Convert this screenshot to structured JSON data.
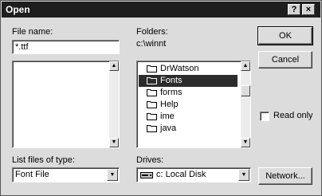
{
  "window": {
    "title": "Open",
    "help_label": "?",
    "close_label": "×"
  },
  "file_name": {
    "label": "File name:",
    "value": "*.ttf"
  },
  "folders": {
    "label": "Folders:",
    "path": "c:\\winnt",
    "items": [
      {
        "name": "DrWatson",
        "selected": false
      },
      {
        "name": "Fonts",
        "selected": true
      },
      {
        "name": "forms",
        "selected": false
      },
      {
        "name": "Help",
        "selected": false
      },
      {
        "name": "ime",
        "selected": false
      },
      {
        "name": "java",
        "selected": false
      }
    ]
  },
  "buttons": {
    "ok": "OK",
    "cancel": "Cancel",
    "network": "Network..."
  },
  "read_only": {
    "label": "Read only",
    "checked": false
  },
  "file_types": {
    "label": "List files of type:",
    "selected": "Font File"
  },
  "drives": {
    "label": "Drives:",
    "selected": "c: Local Disk"
  },
  "icons": {
    "folder": "folder-icon",
    "drive": "hard-drive-icon",
    "scroll_up": "scroll-up-icon",
    "scroll_down": "scroll-down-icon",
    "dropdown": "chevron-down-icon"
  }
}
